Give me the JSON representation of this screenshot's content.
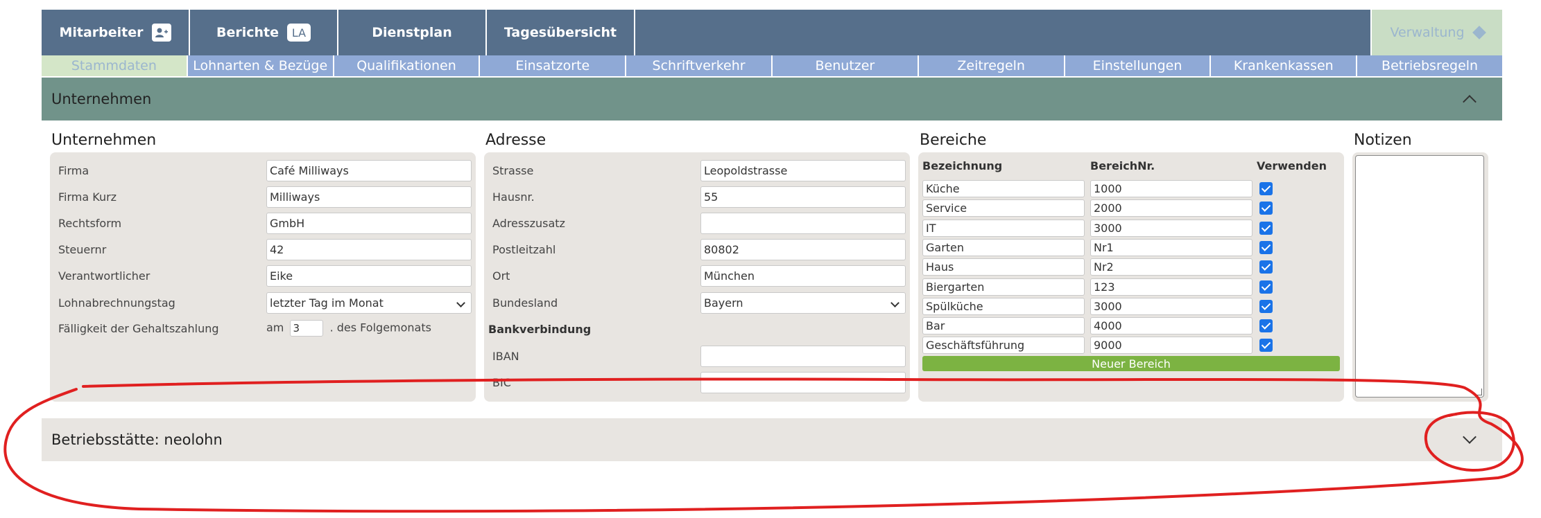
{
  "topnav": {
    "tabs": [
      {
        "label": "Mitarbeiter",
        "icon": "person-add-icon"
      },
      {
        "label": "Berichte",
        "badge": "LA"
      },
      {
        "label": "Dienstplan"
      },
      {
        "label": "Tagesübersicht"
      }
    ],
    "admin": {
      "label": "Verwaltung",
      "icon": "diamond-icon"
    }
  },
  "subnav": {
    "items": [
      "Stammdaten",
      "Lohnarten & Bezüge",
      "Qualifikationen",
      "Einsatzorte",
      "Schriftverkehr",
      "Benutzer",
      "Zeitregeln",
      "Einstellungen",
      "Krankenkassen",
      "Betriebsregeln"
    ],
    "active": "Stammdaten"
  },
  "section": {
    "title": "Unternehmen"
  },
  "company": {
    "title": "Unternehmen",
    "fields": [
      {
        "label": "Firma",
        "value": "Café Milliways"
      },
      {
        "label": "Firma Kurz",
        "value": "Milliways"
      },
      {
        "label": "Rechtsform",
        "value": "GmbH"
      },
      {
        "label": "Steuernr",
        "value": "42"
      },
      {
        "label": "Verantwortlicher",
        "value": "Eike"
      },
      {
        "label": "Lohnabrechnungstag",
        "value": "letzter Tag im Monat"
      }
    ],
    "due": {
      "label": "Fälligkeit der Gehaltszahlung",
      "prefix": "am",
      "value": "3",
      "suffix": ". des Folgemonats"
    }
  },
  "address": {
    "title": "Adresse",
    "fields": [
      {
        "label": "Strasse",
        "value": "Leopoldstrasse"
      },
      {
        "label": "Hausnr.",
        "value": "55"
      },
      {
        "label": "Adresszusatz",
        "value": ""
      },
      {
        "label": "Postleitzahl",
        "value": "80802"
      },
      {
        "label": "Ort",
        "value": "München"
      },
      {
        "label": "Bundesland",
        "value": "Bayern"
      }
    ],
    "bank_title": "Bankverbindung",
    "bank_fields": [
      {
        "label": "IBAN",
        "value": ""
      },
      {
        "label": "BIC",
        "value": ""
      }
    ]
  },
  "areas": {
    "title": "Bereiche",
    "headers": [
      "Bezeichnung",
      "BereichNr.",
      "Verwenden"
    ],
    "rows": [
      {
        "name": "Küche",
        "nr": "1000",
        "checked": true
      },
      {
        "name": "Service",
        "nr": "2000",
        "checked": true
      },
      {
        "name": "IT",
        "nr": "3000",
        "checked": true
      },
      {
        "name": "Garten",
        "nr": "Nr1",
        "checked": true
      },
      {
        "name": "Haus",
        "nr": "Nr2",
        "checked": true
      },
      {
        "name": "Biergarten",
        "nr": "123",
        "checked": true
      },
      {
        "name": "Spülküche",
        "nr": "3000",
        "checked": true
      },
      {
        "name": "Bar",
        "nr": "4000",
        "checked": true
      },
      {
        "name": "Geschäftsführung",
        "nr": "9000",
        "checked": true
      }
    ],
    "new_button": "Neuer Bereich"
  },
  "notes": {
    "title": "Notizen",
    "value": ""
  },
  "site": {
    "title": "Betriebsstätte: neolohn"
  },
  "colors": {
    "nav": "#566f8b",
    "subnav": "#8fa9d6",
    "section": "#71938a",
    "panel": "#e8e5e1",
    "accent_green": "#7cb342",
    "annotation": "#e02020"
  }
}
